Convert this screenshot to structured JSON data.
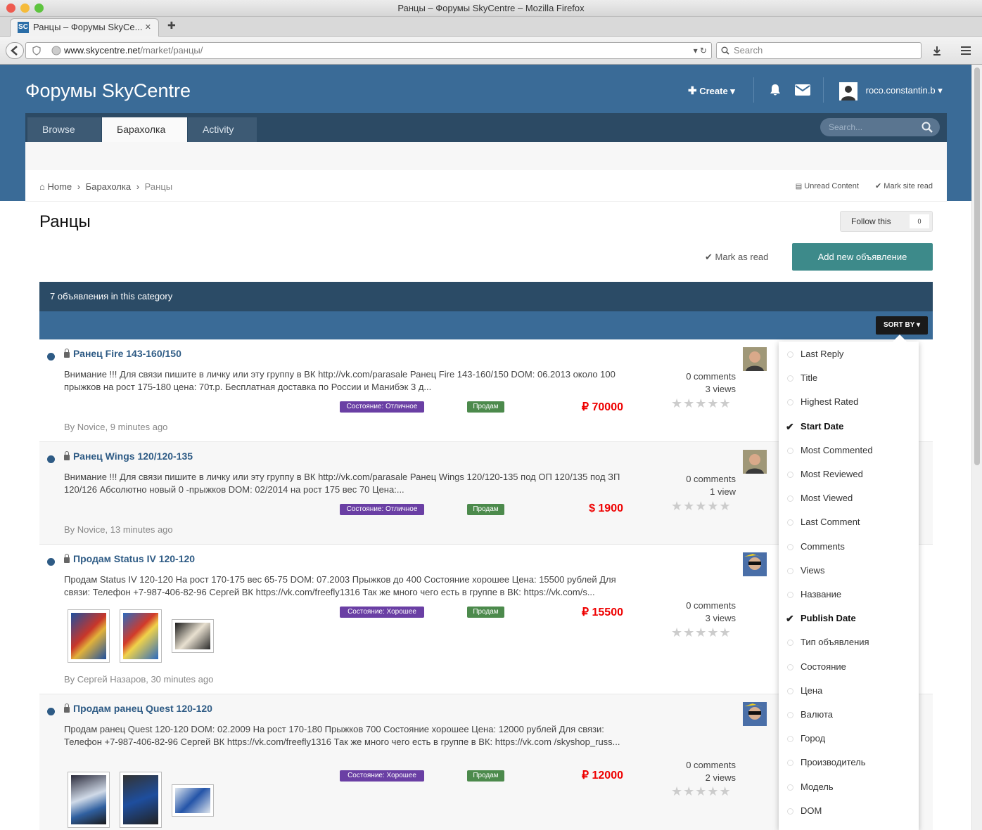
{
  "browser": {
    "window_title": "Ранцы – Форумы SkyCentre – Mozilla Firefox",
    "tab_title": "Ранцы – Форумы SkyCe...",
    "favicon_text": "SC",
    "new_tab_glyph": "✚",
    "close_glyph": "✕",
    "url_host": "www.skycentre.net",
    "url_path": "/market/ранцы/",
    "search_placeholder": "Search"
  },
  "site": {
    "title": "Форумы SkyCentre",
    "create_label": "Create",
    "username": "roco.constantin.b",
    "nav_tabs": [
      {
        "label": "Browse"
      },
      {
        "label": "Барахолка"
      },
      {
        "label": "Activity"
      }
    ],
    "search_placeholder": "Search..."
  },
  "breadcrumb": {
    "home": "Home",
    "level1": "Барахолка",
    "current": "Ранцы"
  },
  "quicklinks": {
    "unread": "Unread Content",
    "mark_site_read": "Mark site read"
  },
  "page": {
    "title": "Ранцы",
    "follow_label": "Follow this",
    "follow_count": "0",
    "mark_read": "Mark as read",
    "add_button": "Add new объявление",
    "count_label": "7 объявления in this category",
    "sort_label": "SORT BY"
  },
  "listings": [
    {
      "title": "Ранец Fire 143-160/150",
      "desc": "Внимание !!! Для связи пишите в личку или эту группу в ВК http://vk.com/parasale   Ранец Fire 143-160/150 DOM: 06.2013 около 100 прыжков на рост 175-180   цена: 70т.р. Бесплатная доставка по России и Манибэк 3 д...",
      "state": "Состояние: Отличное",
      "type": "Продам",
      "price": "₽ 70000",
      "comments": "0 comments",
      "views": "3 views",
      "stars": "★★★★★",
      "byline": "By Novice, 9 minutes ago"
    },
    {
      "title": "Ранец Wings 120/120-135",
      "desc": "Внимание !!! Для связи пишите в личку или эту группу в ВК http://vk.com/parasale   Ранец Wings 120/120-135 под ОП 120/135 под ЗП 120/126 Абсолютно новый 0 -прыжков DOM: 02/2014 на рост 175 вес 70   Цена:...",
      "state": "Состояние: Отличное",
      "type": "Продам",
      "price": "$ 1900",
      "comments": "0 comments",
      "views": "1 view",
      "stars": "★★★★★",
      "byline": "By Novice, 13 minutes ago"
    },
    {
      "title": "Продам Status IV 120-120",
      "desc": "Продам Status IV 120-120 На рост 170-175 вес 65-75 DOM: 07.2003 Прыжков до 400 Состояние хорошее Цена: 15500 рублей Для связи: Телефон +7-987-406-82-96 Сергей ВК https://vk.com/freefly1316 Так же много чего есть в группе в ВК: https://vk.com/s...",
      "state": "Состояние: Хорошее",
      "type": "Продам",
      "price": "₽ 15500",
      "comments": "0 comments",
      "views": "3 views",
      "stars": "★★★★★",
      "byline": "By Сергей Назаров, 30 minutes ago"
    },
    {
      "title": "Продам ранец Quest 120-120",
      "desc": "Продам ранец Quest 120-120 DOM: 02.2009 На рост 170-180 Прыжков 700 Состояние хорошее Цена: 12000 рублей Для связи: Телефон +7-987-406-82-96 Сергей ВК https://vk.com/freefly1316 Так же много чего есть в группе в ВК: https://vk.com /skyshop_russ...",
      "state": "Состояние: Хорошее",
      "type": "Продам",
      "price": "₽ 12000",
      "comments": "0 comments",
      "views": "2 views",
      "stars": "★★★★★"
    }
  ],
  "sort_options": [
    {
      "label": "Last Reply",
      "selected": false
    },
    {
      "label": "Title",
      "selected": false
    },
    {
      "label": "Highest Rated",
      "selected": false
    },
    {
      "label": "Start Date",
      "selected": true
    },
    {
      "label": "Most Commented",
      "selected": false
    },
    {
      "label": "Most Reviewed",
      "selected": false
    },
    {
      "label": "Most Viewed",
      "selected": false
    },
    {
      "label": "Last Comment",
      "selected": false
    },
    {
      "label": "Comments",
      "selected": false
    },
    {
      "label": "Views",
      "selected": false
    },
    {
      "label": "Название",
      "selected": false
    },
    {
      "label": "Publish Date",
      "selected": true
    },
    {
      "label": "Тип объявления",
      "selected": false
    },
    {
      "label": "Состояние",
      "selected": false
    },
    {
      "label": "Цена",
      "selected": false
    },
    {
      "label": "Валюта",
      "selected": false
    },
    {
      "label": "Город",
      "selected": false
    },
    {
      "label": "Производитель",
      "selected": false
    },
    {
      "label": "Модель",
      "selected": false
    },
    {
      "label": "DOM",
      "selected": false
    }
  ],
  "colors": {
    "header_blue": "#3a6b97",
    "nav_dark": "#2c4a64",
    "accent_teal": "#3d8a8a",
    "price_red": "#ee0000",
    "badge_purple": "#6a3fa4",
    "badge_green": "#4c8a4c"
  },
  "icons": {
    "check": "✔",
    "chevron": "›",
    "caret": "▾"
  }
}
